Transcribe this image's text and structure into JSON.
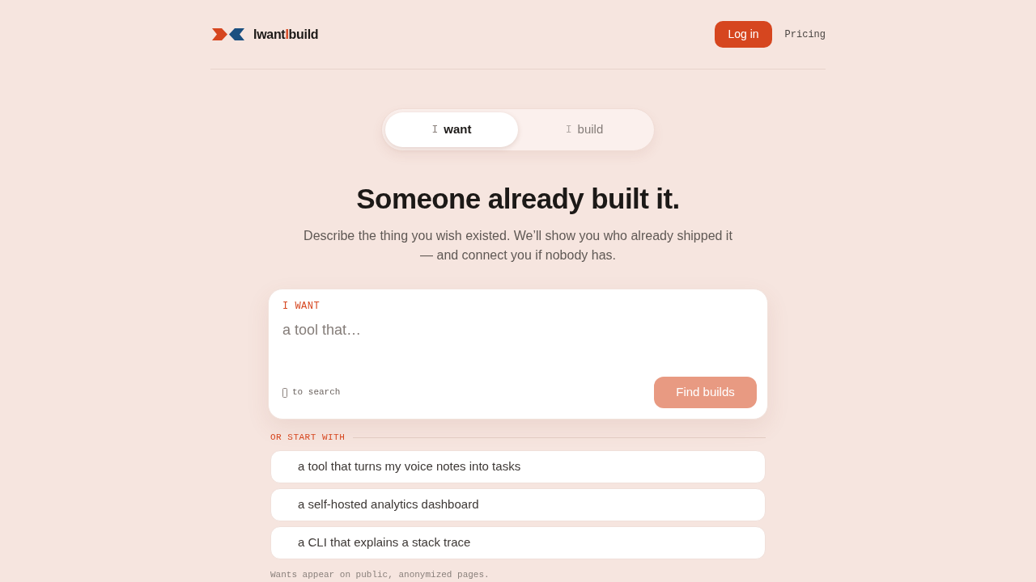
{
  "header": {
    "logo": {
      "parts": [
        {
          "text": "Iwant",
          "accent": false
        },
        {
          "text": "I",
          "accent": true
        },
        {
          "text": "build",
          "accent": false
        }
      ]
    },
    "login_button": "Log in",
    "nav_link": "Pricing"
  },
  "mode_tabs": [
    {
      "prefix": "I",
      "label": "want",
      "selected": true
    },
    {
      "prefix": "I",
      "label": "build",
      "selected": false
    }
  ],
  "hero": {
    "title": "Someone already built it.",
    "subtitle": "Describe the thing you wish existed. We’ll show you who already shipped it — and connect you if nobody has."
  },
  "want_card": {
    "label": "I WANT",
    "input": {
      "placeholder": "a tool that…"
    },
    "hint": "to search",
    "submit": {
      "label": "Find builds",
      "disabled": true
    }
  },
  "suggestions": {
    "heading": "OR START WITH",
    "items": [
      "a tool that turns my voice notes into tasks",
      "a self-hosted analytics dashboard",
      "a CLI that explains a stack trace"
    ]
  },
  "footnote": "Wants appear on public, anonymized pages."
}
